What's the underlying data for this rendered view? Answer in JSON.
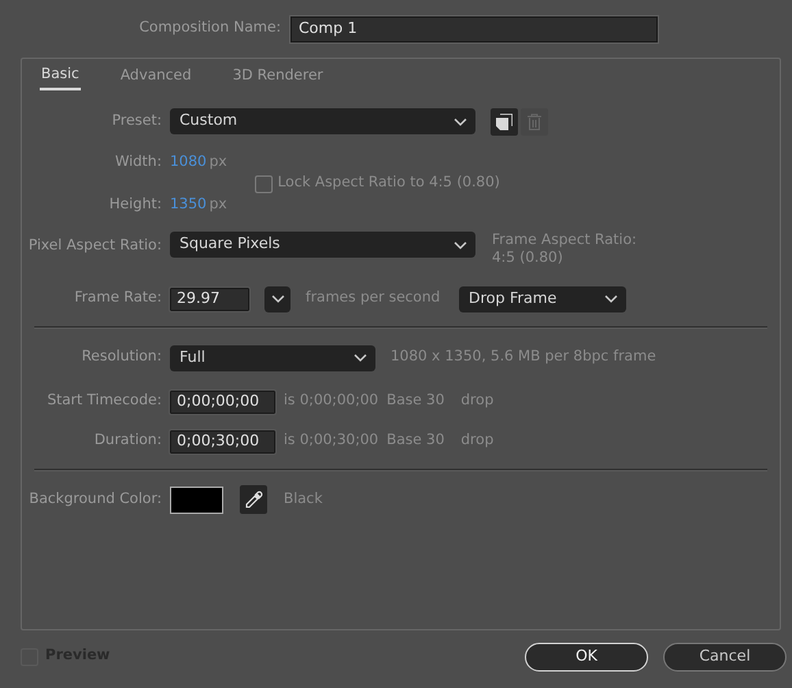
{
  "composition_name": {
    "label": "Composition Name:",
    "value": "Comp 1"
  },
  "tabs": [
    {
      "label": "Basic",
      "selected": true
    },
    {
      "label": "Advanced",
      "selected": false
    },
    {
      "label": "3D Renderer",
      "selected": false
    }
  ],
  "preset": {
    "label": "Preset:",
    "value": "Custom"
  },
  "width": {
    "label": "Width:",
    "value": "1080",
    "unit": "px"
  },
  "height": {
    "label": "Height:",
    "value": "1350",
    "unit": "px"
  },
  "lock_aspect": {
    "label": "Lock Aspect Ratio to 4:5 (0.80)",
    "checked": false
  },
  "pixel_aspect": {
    "label": "Pixel Aspect Ratio:",
    "value": "Square Pixels"
  },
  "frame_aspect": {
    "label": "Frame Aspect Ratio:",
    "value": "4:5 (0.80)"
  },
  "frame_rate": {
    "label": "Frame Rate:",
    "value": "29.97",
    "unit": "frames per second",
    "mode": "Drop Frame"
  },
  "resolution": {
    "label": "Resolution:",
    "value": "Full",
    "info": "1080 x 1350, 5.6 MB per 8bpc frame"
  },
  "timecodes": [
    {
      "label": "Start Timecode:",
      "value": "0;00;00;00",
      "is": "is 0;00;00;00",
      "base": "Base 30",
      "drop": "drop"
    },
    {
      "label": "Duration:",
      "value": "0;00;30;00",
      "is": "is 0;00;30;00",
      "base": "Base 30",
      "drop": "drop"
    }
  ],
  "background_color": {
    "label": "Background Color:",
    "color": "#000000",
    "name": "Black"
  },
  "preview": {
    "label": "Preview",
    "checked": false,
    "disabled": true
  },
  "buttons": [
    {
      "label": "OK",
      "default": true
    },
    {
      "label": "Cancel",
      "default": false
    }
  ]
}
